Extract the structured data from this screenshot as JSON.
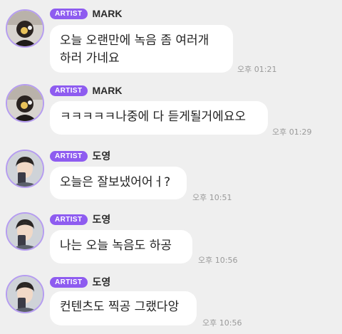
{
  "messages": [
    {
      "badge": "ARTIST",
      "name": "MARK",
      "lines": [
        "오늘 오랜만에 녹음 좀 여러개",
        "하러 가네요"
      ],
      "time": "오후 01:21",
      "avatar": "mark-avatar"
    },
    {
      "badge": "ARTIST",
      "name": "MARK",
      "lines": [
        "ㅋㅋㅋㅋㅋ나중에 다 듣게될거에요오"
      ],
      "time": "오후 01:29",
      "avatar": "mark-avatar"
    },
    {
      "badge": "ARTIST",
      "name": "도영",
      "lines": [
        "오늘은 잘보냈어어ㅓ?"
      ],
      "time": "오후 10:51",
      "avatar": "doyoung-avatar"
    },
    {
      "badge": "ARTIST",
      "name": "도영",
      "lines": [
        "나는 오늘 녹음도 하공"
      ],
      "time": "오후 10:56",
      "avatar": "doyoung-avatar"
    },
    {
      "badge": "ARTIST",
      "name": "도영",
      "lines": [
        "컨텐츠도 찍공 그랬다앙"
      ],
      "time": "오후 10:56",
      "avatar": "doyoung-avatar"
    }
  ],
  "colors": {
    "background": "#efefef",
    "badge": "#8e5cf0",
    "avatar_ring": "#b59cf0",
    "bubble": "#ffffff",
    "timestamp": "#9a9a9a"
  }
}
